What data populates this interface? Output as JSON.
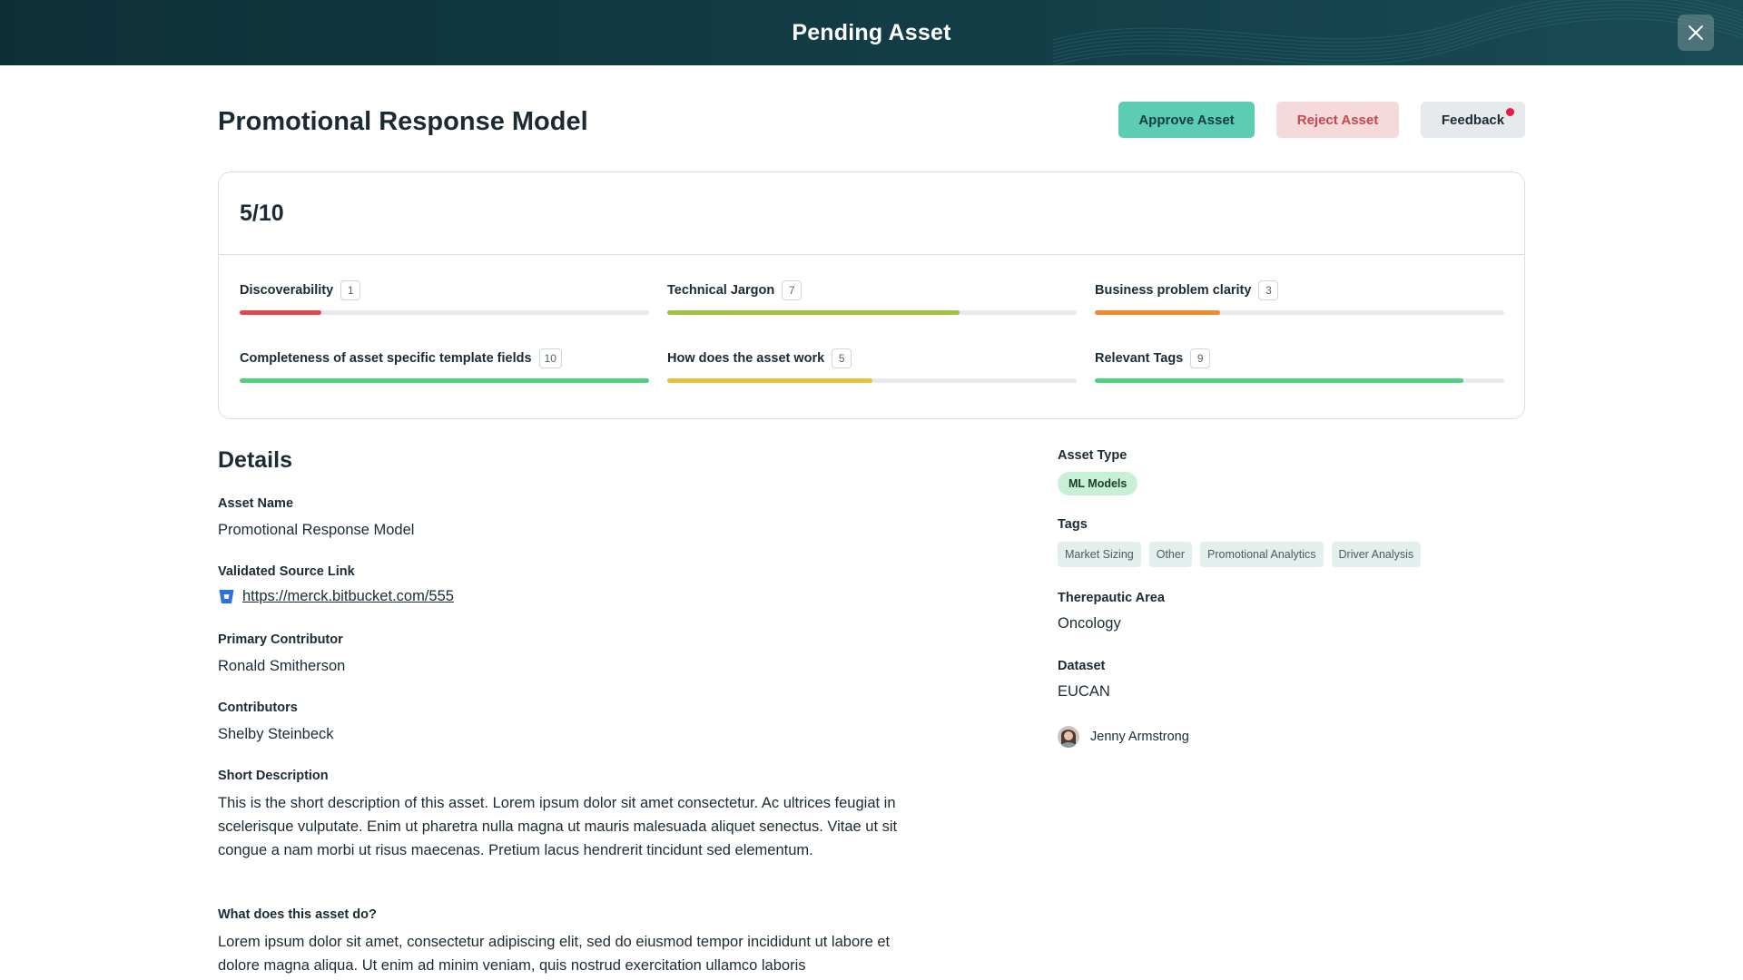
{
  "header": {
    "title": "Pending Asset"
  },
  "asset": {
    "title": "Promotional Response Model"
  },
  "actions": {
    "approve_label": "Approve Asset",
    "reject_label": "Reject Asset",
    "feedback_label": "Feedback"
  },
  "score": {
    "total": "5/10",
    "metrics": [
      {
        "label": "Discoverability",
        "score": "1",
        "fraction": 0.2,
        "color": "#e0474e"
      },
      {
        "label": "Technical Jargon",
        "score": "7",
        "fraction": 0.713,
        "color": "#9cc33b"
      },
      {
        "label": "Business problem clarity",
        "score": "3",
        "fraction": 0.305,
        "color": "#ee8b2c"
      },
      {
        "label": "Completeness of asset specific template fields",
        "score": "10",
        "fraction": 1.0,
        "color": "#4fd07b"
      },
      {
        "label": "How does the asset work",
        "score": "5",
        "fraction": 0.5,
        "color": "#e6c041"
      },
      {
        "label": "Relevant Tags",
        "score": "9",
        "fraction": 0.9,
        "color": "#4fd07b"
      }
    ]
  },
  "details": {
    "title": "Details",
    "asset_name_label": "Asset Name",
    "asset_name": "Promotional Response Model",
    "source_link_label": "Validated Source Link",
    "source_link": "https://merck.bitbucket.com/555",
    "primary_contributor_label": "Primary Contributor",
    "primary_contributor": "Ronald Smitherson",
    "contributors_label": "Contributors",
    "contributors": "Shelby Steinbeck",
    "short_description_label": "Short Description",
    "short_description": "This is the short description of this asset. Lorem ipsum dolor sit amet consectetur. Ac ultrices feugiat in scelerisque vulputate. Enim ut pharetra nulla magna ut mauris malesuada aliquet senectus. Vitae ut sit congue a nam morbi ut risus maecenas. Pretium lacus hendrerit tincidunt sed elementum.",
    "what_does_label": "What does this asset do?",
    "what_does": "Lorem ipsum dolor sit amet, consectetur adipiscing elit, sed do eiusmod tempor incididunt ut labore et dolore magna aliqua. Ut enim ad minim veniam, quis nostrud exercitation ullamco laboris"
  },
  "side": {
    "asset_type_label": "Asset Type",
    "asset_type": "ML Models",
    "tags_label": "Tags",
    "tags": [
      "Market Sizing",
      "Other",
      "Promotional Analytics",
      "Driver Analysis"
    ],
    "therapeutic_area_label": "Therepautic Area",
    "therapeutic_area": "Oncology",
    "dataset_label": "Dataset",
    "dataset": "EUCAN",
    "person": "Jenny Armstrong"
  },
  "icons": {
    "close": "close-icon",
    "source": "bitbucket-icon",
    "avatar": "avatar"
  }
}
